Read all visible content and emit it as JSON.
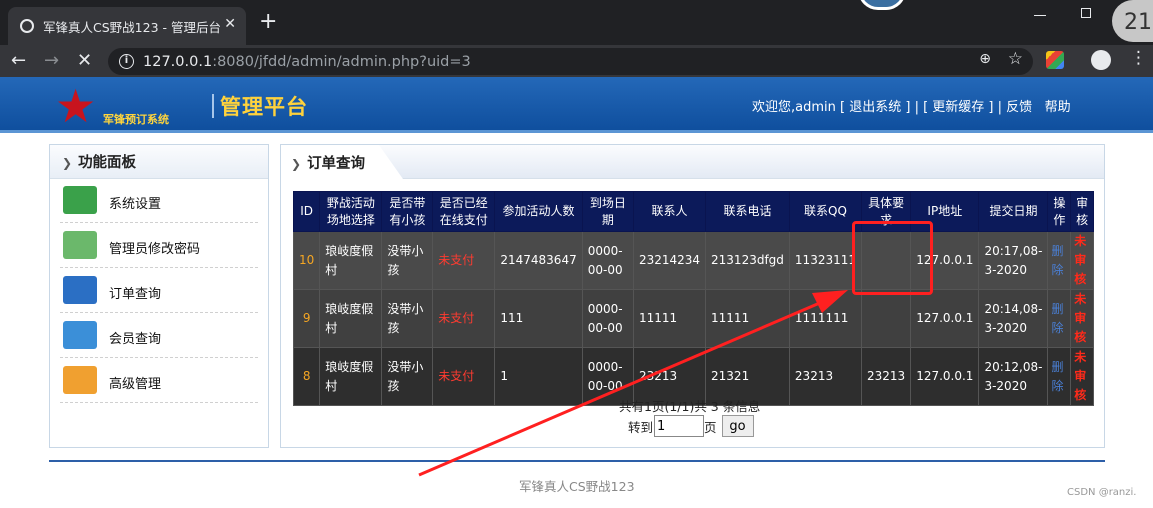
{
  "browser": {
    "tab_title": "军锋真人CS野战123 - 管理后台",
    "tab_close": "✕",
    "new_tab": "+",
    "url_host": "127.0.0.1",
    "url_rest": ":8080/jfdd/admin/admin.php?uid=3",
    "clock_text": "21"
  },
  "header": {
    "logo_text": "军锋预订系统",
    "brand": "管理平台",
    "welcome": "欢迎您,admin",
    "logout": "[ 退出系统 ]",
    "sep1": " | ",
    "refresh_cache": "[ 更新缓存 ]",
    "sep2": " | ",
    "feedback": "反馈",
    "help": "帮助"
  },
  "sidebar": {
    "title": "功能面板",
    "items": [
      {
        "label": "系统设置",
        "color": "#3aa14a"
      },
      {
        "label": "管理员修改密码",
        "color": "#6bb86b"
      },
      {
        "label": "订单查询",
        "color": "#2b6fc4"
      },
      {
        "label": "会员查询",
        "color": "#3b8fd8"
      },
      {
        "label": "高级管理",
        "color": "#f0a030"
      }
    ]
  },
  "main": {
    "title": "订单查询",
    "columns": [
      "ID",
      "野战活动场地选择",
      "是否带有小孩",
      "是否已经在线支付",
      "参加活动人数",
      "到场日期",
      "联系人",
      "联系电话",
      "联系QQ",
      "具体要求",
      "IP地址",
      "提交日期",
      "操作",
      "审核"
    ],
    "rows": [
      {
        "id": "10",
        "venue": "琅岐度假村",
        "kids": "没带小孩",
        "paid": "未支付",
        "count": "2147483647",
        "date": "0000-00-00",
        "contact": "23214234",
        "phone": "213123dfgd",
        "qq": "11323111",
        "req": "",
        "ip": "127.0.0.1",
        "submitted": "20:17,08-3-2020",
        "op": "删除",
        "review": "未审核"
      },
      {
        "id": "9",
        "venue": "琅岐度假村",
        "kids": "没带小孩",
        "paid": "未支付",
        "count": "111",
        "date": "0000-00-00",
        "contact": "11111",
        "phone": "11111",
        "qq": "1111111",
        "req": "",
        "ip": "127.0.0.1",
        "submitted": "20:14,08-3-2020",
        "op": "删除",
        "review": "未审核"
      },
      {
        "id": "8",
        "venue": "琅岐度假村",
        "kids": "没带小孩",
        "paid": "未支付",
        "count": "1",
        "date": "0000-00-00",
        "contact": "23213",
        "phone": "21321",
        "qq": "23213",
        "req": "23213",
        "ip": "127.0.0.1",
        "submitted": "20:12,08-3-2020",
        "op": "删除",
        "review": "未审核"
      }
    ],
    "pager_text": "共有1页(1/1)共 3  条信息",
    "jump_label": "转到",
    "jump_value": "1",
    "page_unit": "页",
    "go_label": "go"
  },
  "footer": {
    "text": "军锋真人CS野战123",
    "watermark": "CSDN @ranzi."
  },
  "colors": {
    "header_blue": "#1a5fae",
    "table_header": "#0c1a5a",
    "annotation_red": "#ff2020"
  }
}
